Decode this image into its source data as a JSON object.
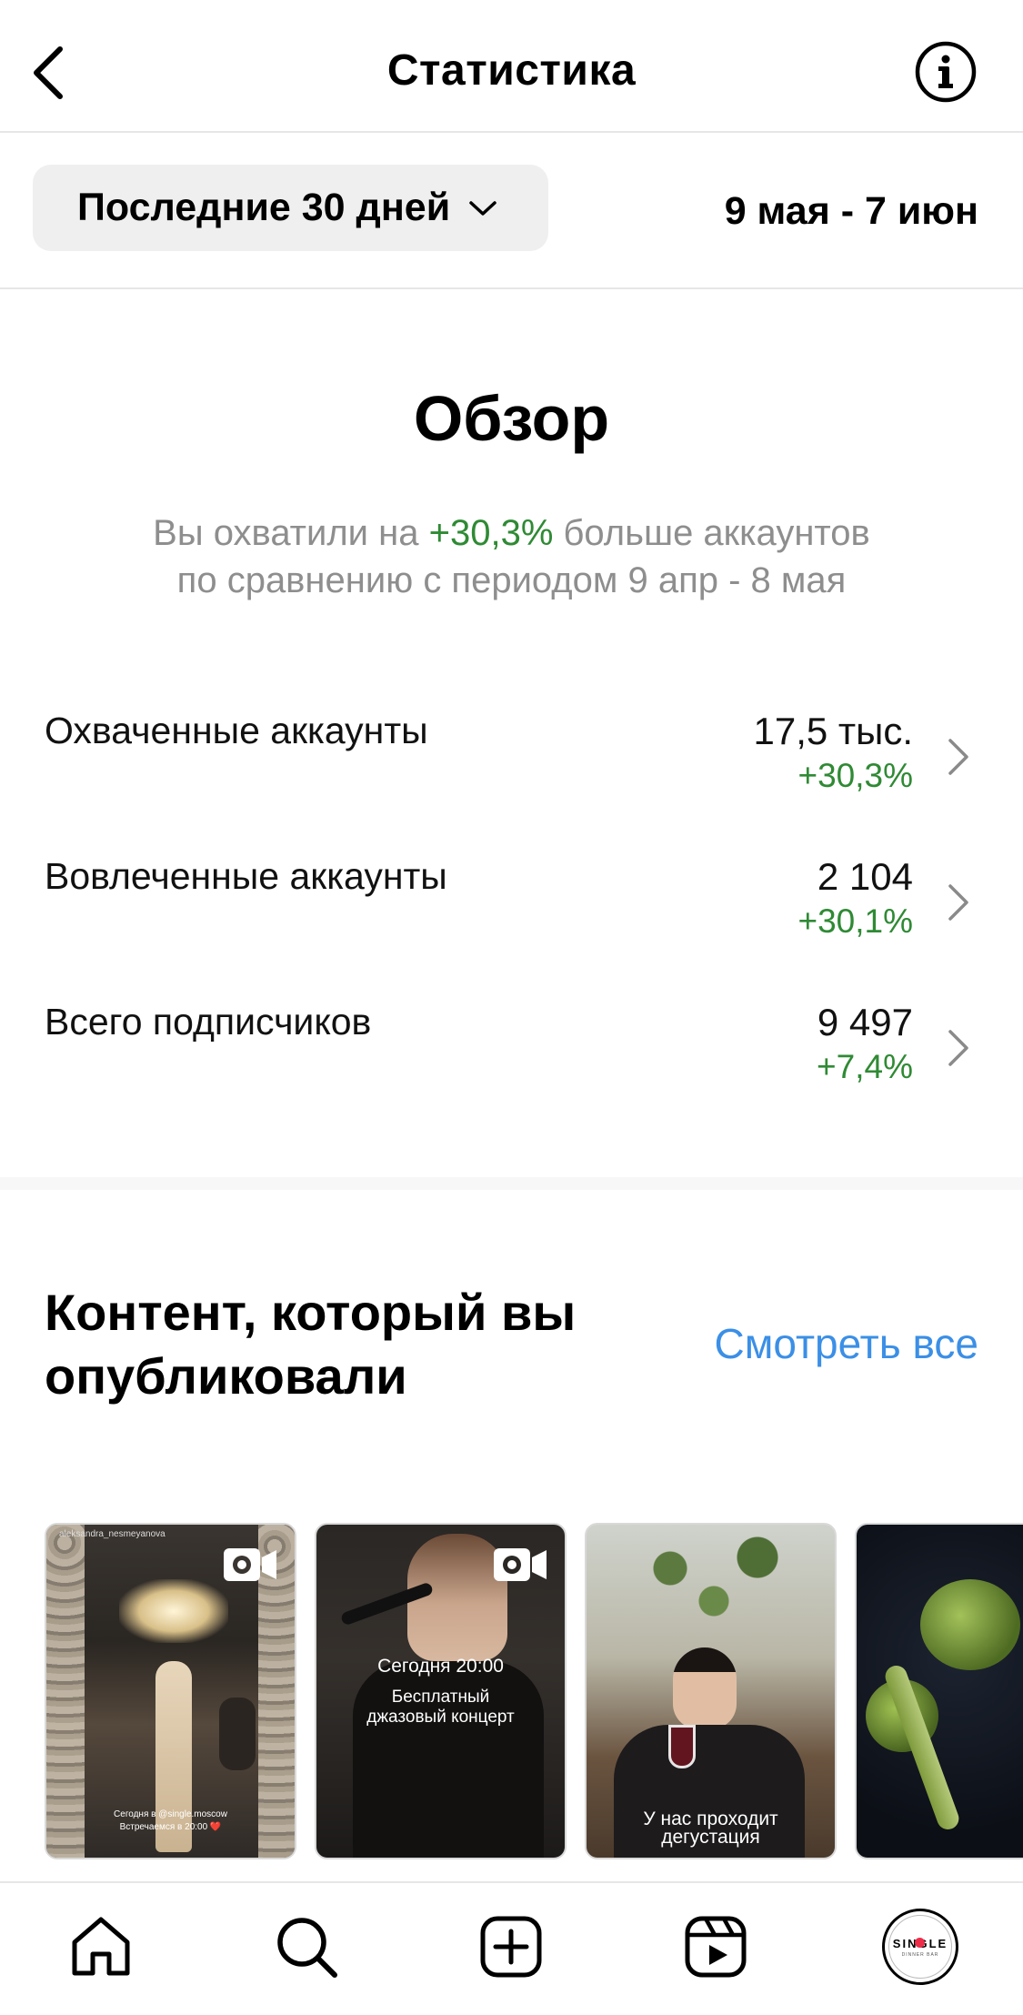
{
  "header": {
    "title": "Статистика"
  },
  "period": {
    "selector_label": "Последние 30 дней",
    "date_range": "9 мая - 7 июн"
  },
  "overview": {
    "title": "Обзор",
    "summary_prefix": "Вы охватили на",
    "summary_highlight": "+30,3%",
    "summary_suffix": "больше аккаунтов",
    "summary_line2": "по сравнению с периодом 9 апр - 8 мая"
  },
  "metrics": [
    {
      "label": "Охваченные аккаунты",
      "value": "17,5 тыс.",
      "change": "+30,3%"
    },
    {
      "label": "Вовлеченные аккаунты",
      "value": "2 104",
      "change": "+30,1%"
    },
    {
      "label": "Всего подписчиков",
      "value": "9 497",
      "change": "+7,4%"
    }
  ],
  "content": {
    "title": "Контент, который вы опубликовали",
    "see_all": "Смотреть все",
    "thumbnails": [
      {
        "username": "aleksandra_nesmeyanova",
        "caption1": "Сегодня в @single.moscow",
        "caption2": "Встречаемся в 20:00 ❤️"
      },
      {
        "caption1": "Сегодня 20:00",
        "caption2": "Бесплатный",
        "caption3": "джазовый концерт"
      },
      {
        "caption1": "У нас проходит",
        "caption2": "дегустация"
      },
      {}
    ]
  },
  "profile": {
    "avatar_text": "SINGLE",
    "avatar_sub": "DINNER BAR"
  },
  "colors": {
    "accent_green": "#2f8a34",
    "link_blue": "#3b8fe6",
    "notification": "#ed2d49"
  }
}
